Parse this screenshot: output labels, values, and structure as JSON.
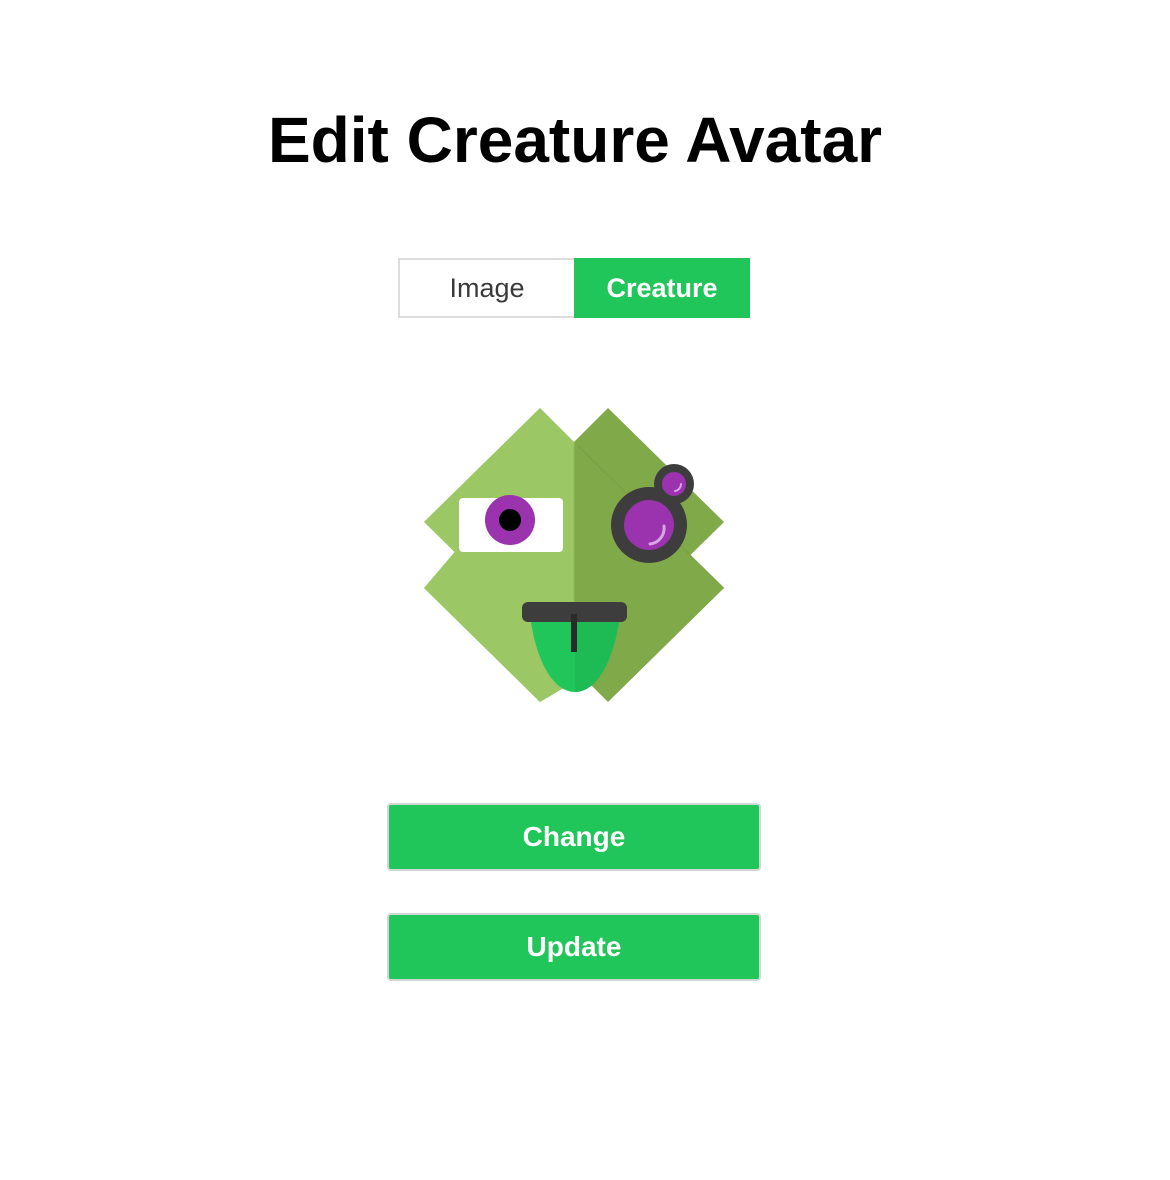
{
  "page": {
    "title": "Edit Creature Avatar"
  },
  "toggle": {
    "options": [
      "Image",
      "Creature"
    ],
    "selected": "Creature"
  },
  "avatar": {
    "icon": "creature-avatar-icon",
    "colors": {
      "body_light": "#9bc764",
      "body_dark": "#80a94a",
      "eye_white": "#ffffff",
      "iris": "#9a33ad",
      "pupil": "#000000",
      "goggle_ring": "#3d3d3d",
      "mouth": "#3d3d3d",
      "tongue": "#21c65a"
    }
  },
  "actions": {
    "change_label": "Change",
    "update_label": "Update"
  },
  "colors": {
    "accent": "#21c65a",
    "text": "#000000",
    "border": "#dcdcdc"
  }
}
